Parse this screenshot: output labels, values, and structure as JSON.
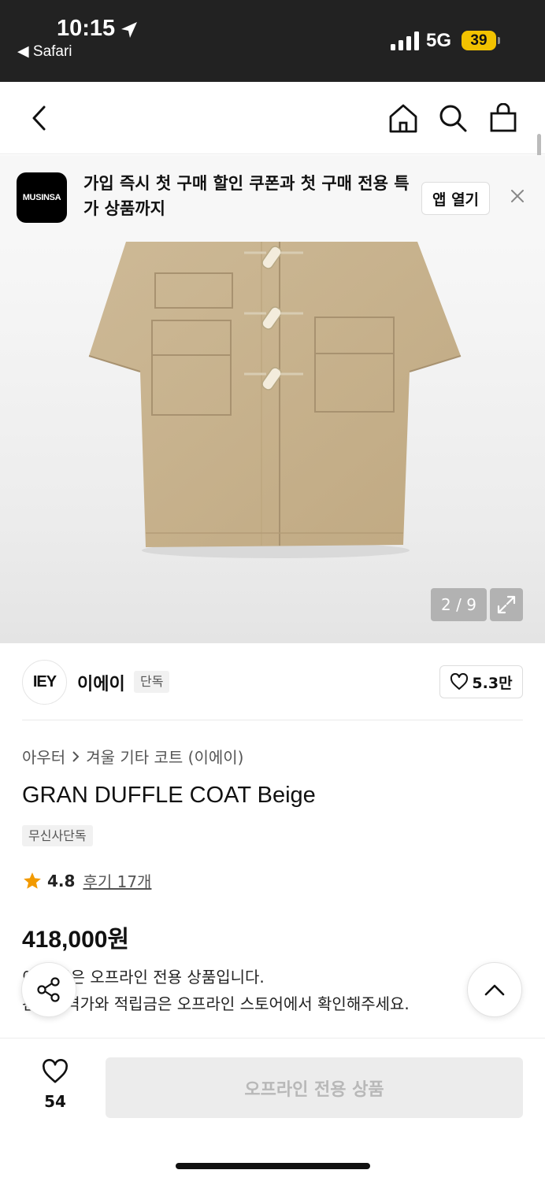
{
  "status_bar": {
    "time": "10:15",
    "back_app": "◀ Safari",
    "network": "5G",
    "battery": "39"
  },
  "nav": {
    "back_icon": "chevron-left-icon",
    "home_icon": "home-icon",
    "search_icon": "search-icon",
    "cart_icon": "shopping-bag-icon"
  },
  "banner": {
    "logo_text": "MUSINSA",
    "message": "가입 즉시 첫 구매 할인 쿠폰과 첫 구매 전용 특가 상품까지",
    "open_label": "앱 열기"
  },
  "image": {
    "counter": "2 / 9",
    "current_index": 2,
    "total": 9
  },
  "brand": {
    "logo_text": "IEY",
    "name": "이에이",
    "badge": "단독",
    "like_count": "5.3만"
  },
  "breadcrumb": {
    "category": "아우터",
    "subcategory": "겨울 기타 코트 (이에이)"
  },
  "product": {
    "title": "GRAN DUFFLE COAT Beige",
    "tag": "무신사단독",
    "rating": "4.8",
    "reviews": "후기 17개",
    "price": "418,000원",
    "notice_line1": "이 상품은 오프라인 전용 상품입니다.",
    "notice_line2": "판매가격가와 적립금은 오프라인 스토어에서 확인해주세요."
  },
  "bottom": {
    "wish_count": "54",
    "buy_label": "오프라인 전용 상품"
  },
  "colors": {
    "accent_star": "#f29a00",
    "coat": "#c8b391",
    "status_bg": "#222222",
    "battery": "#f2c200"
  }
}
